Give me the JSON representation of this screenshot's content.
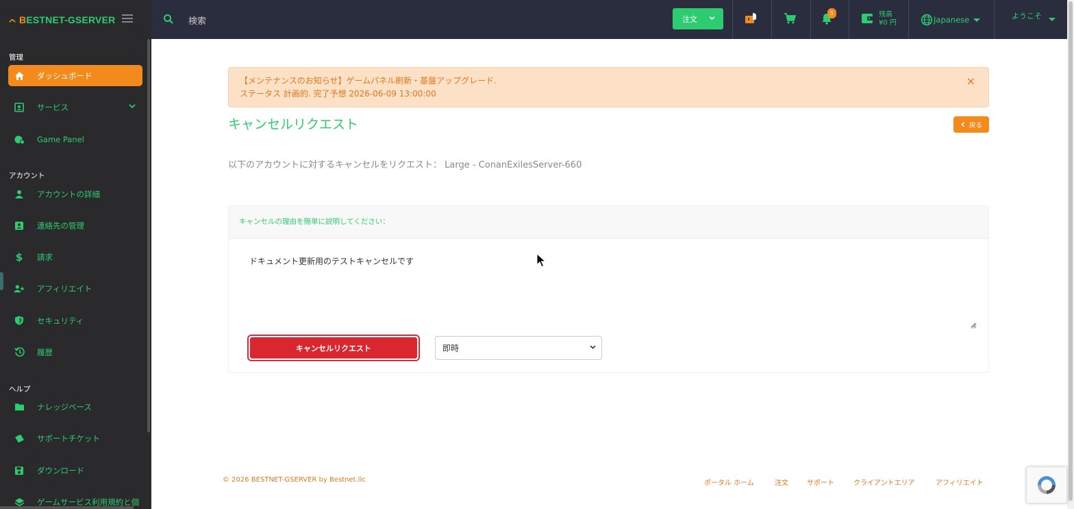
{
  "brand": {
    "name_first": "B",
    "name_rest": "ESTNET-GSERVER"
  },
  "sidebar": {
    "section_manage": "管理",
    "section_account": "アカウント",
    "section_help": "ヘルプ",
    "items": [
      {
        "label": "ダッシュボード",
        "icon": "home-icon",
        "active": true
      },
      {
        "label": "サービス",
        "icon": "id-card-icon"
      },
      {
        "label": "Game Panel",
        "icon": "gamepad-icon"
      },
      {
        "label": "アカウントの詳細",
        "icon": "user-icon"
      },
      {
        "label": "連絡先の管理",
        "icon": "contact-icon"
      },
      {
        "label": "請求",
        "icon": "dollar-icon"
      },
      {
        "label": "アフィリエイト",
        "icon": "user-plus-icon"
      },
      {
        "label": "セキュリティ",
        "icon": "shield-icon"
      },
      {
        "label": "履歴",
        "icon": "history-icon"
      },
      {
        "label": "ナレッジベース",
        "icon": "folder-icon"
      },
      {
        "label": "サポートチケット",
        "icon": "ticket-icon"
      },
      {
        "label": "ダウンロード",
        "icon": "save-icon"
      },
      {
        "label": "ゲームサービス利用規約と個",
        "icon": "layers-icon"
      }
    ]
  },
  "topbar": {
    "search_placeholder": "検索",
    "order_label": "注文",
    "notifications_count": "5",
    "balance_label": "残高",
    "balance_value": "¥0 円",
    "language": "Japanese",
    "welcome": "ようこそ"
  },
  "alert": {
    "line1": "【メンテナンスのお知らせ】ゲームパネル刷新・基盤アップグレード.",
    "line2": "ステータス 計画的. 完了予想 2026-06-09 13:00:00",
    "close": "×"
  },
  "page": {
    "title": "キャンセルリクエスト",
    "back_label": "戻る",
    "subtitle": "以下のアカウントに対するキャンセルをリクエスト： Large - ConanExilesServer-660"
  },
  "form": {
    "reason_label": "キャンセルの理由を簡単に説明してください：",
    "reason_value": "ドキュメント更新用のテストキャンセルです",
    "submit_label": "キャンセルリクエスト",
    "type_selected": "即時"
  },
  "footer": {
    "copyright": "© 2026 BESTNET-GSERVER by Bestnet.llc",
    "links": [
      "ポータル ホーム",
      "注文",
      "サポート",
      "クライアントエリア",
      "アフィリエイト"
    ]
  },
  "colors": {
    "accent_green": "#2ecc71",
    "accent_orange": "#f28a1c",
    "danger": "#d9262f",
    "sidebar_bg": "#2a2a2c",
    "topbar_bg": "#2a2d3e"
  }
}
